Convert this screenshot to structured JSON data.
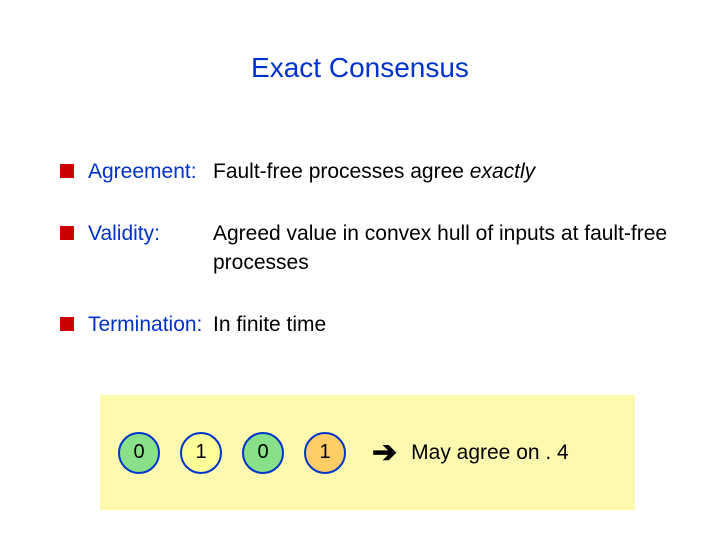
{
  "title": "Exact Consensus",
  "items": [
    {
      "term": "Agreement:",
      "desc_pre": "Fault-free processes agree ",
      "desc_em": "exactly",
      "desc_post": ""
    },
    {
      "term": "Validity:",
      "desc_pre": "Agreed value in convex hull of inputs at fault-free processes",
      "desc_em": "",
      "desc_post": ""
    },
    {
      "term": "Termination:",
      "desc_pre": "In finite time",
      "desc_em": "",
      "desc_post": ""
    }
  ],
  "panel": {
    "nodes": [
      "0",
      "1",
      "0",
      "1"
    ],
    "arrow": "➔",
    "text": "May agree on . 4"
  }
}
